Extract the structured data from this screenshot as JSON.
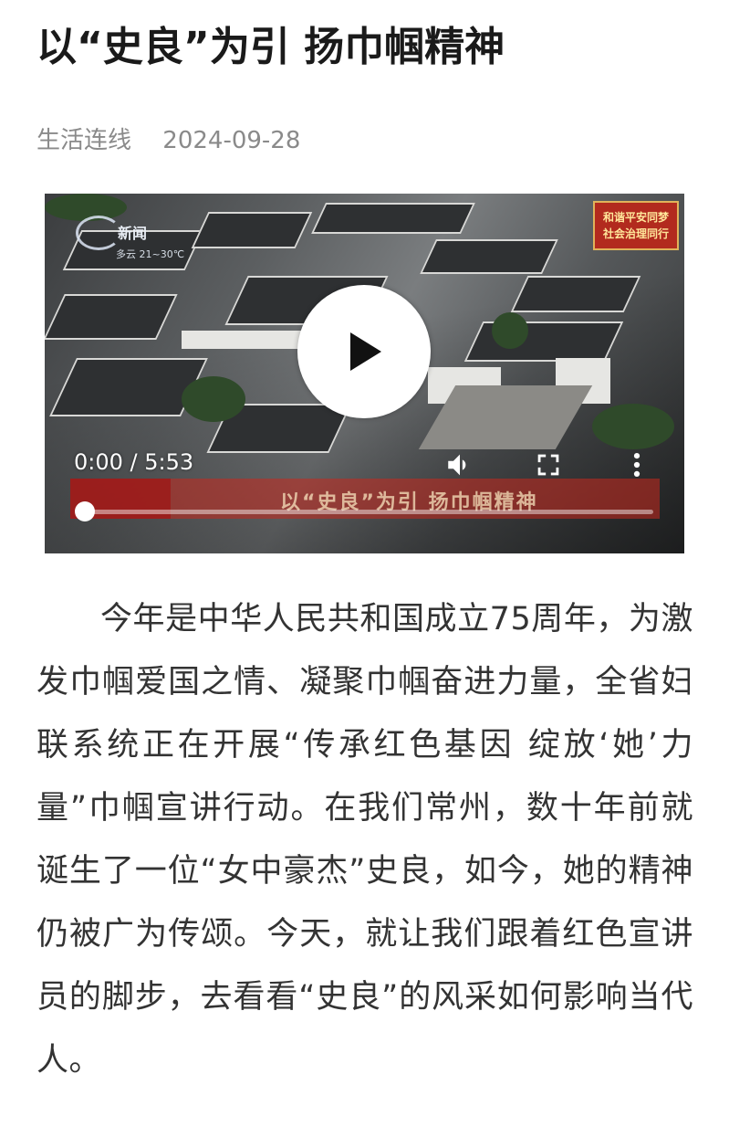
{
  "article": {
    "title": "以“史良”为引 扬巾帼精神",
    "source": "生活连线",
    "date": "2024-09-28",
    "body": "今年是中华人民共和国成立75周年，为激发巾帼爱国之情、凝聚巾帼奋进力量，全省妇联系统正在开展“传承红色基因 绽放‘她’力量”巾帼宣讲行动。在我们常州，数十年前就诞生了一位“女中豪杰”史良，如今，她的精神仍被广为传颂。今天，就让我们跟着红色宣讲员的脚步，去看看“史良”的风采如何影响当代人。"
  },
  "video": {
    "time_display": "0:00 / 5:53",
    "current_time": "0:00",
    "duration": "5:53",
    "progress_fraction": 0.0,
    "play_icon": "play-icon",
    "volume_icon": "volume-icon",
    "fullscreen_icon": "fullscreen-icon",
    "more_icon": "more-vertical-icon",
    "overlay": {
      "channel": "新闻",
      "weather": "多云 21~30℃",
      "badge_line1": "和谐平安同梦",
      "badge_line2": "社会治理同行",
      "caption": "以“史良”为引 扬巾帼精神"
    }
  },
  "colors": {
    "title": "#1a1a1a",
    "meta": "#8a8a8a",
    "body_text": "#333333",
    "video_controls": "#ffffff"
  }
}
